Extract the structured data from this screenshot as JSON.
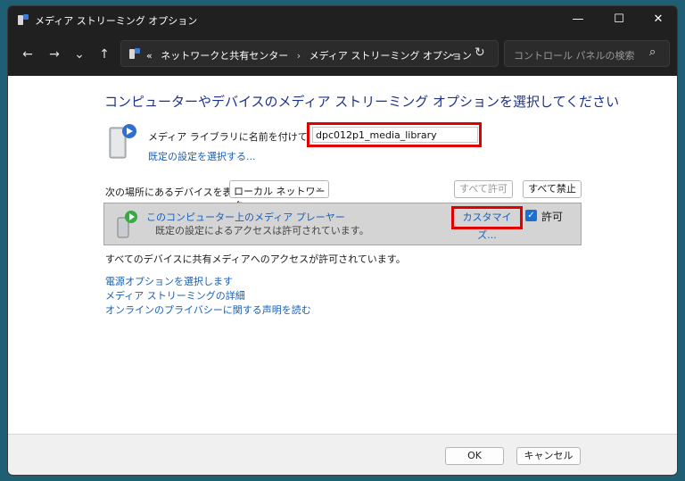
{
  "window": {
    "title": "メディア ストリーミング オプション",
    "minimize": "—",
    "maximize": "☐",
    "close": "✕"
  },
  "nav": {
    "back": "←",
    "forward": "→",
    "recent": "⌄",
    "up": "↑",
    "breadcrumb_prefix": "«",
    "crumbs": [
      "ネットワークと共有センター",
      "メディア ストリーミング オプション"
    ],
    "separator": "›",
    "dropdown": "⌄",
    "refresh": "↻",
    "search_placeholder": "コントロール パネルの検索",
    "search_icon": "⌕"
  },
  "main": {
    "heading": "コンピューターやデバイスのメディア ストリーミング オプションを選択してください",
    "library_label": "メディア ライブラリに名前を付けてください:",
    "library_name": "dpc012p1_media_library",
    "default_link": "既定の設定を選択する...",
    "show_devices_label": "次の場所にあるデバイスを表示:",
    "network_option": "ローカル ネットワーク",
    "allow_all": "すべて許可",
    "block_all": "すべて禁止",
    "device": {
      "name": "このコンピューター上のメディア プレーヤー",
      "description": "既定の設定によるアクセスは許可されています。",
      "customize": "カスタマイズ...",
      "allow_label": "許可",
      "allowed": true
    },
    "all_allowed_text": "すべてのデバイスに共有メディアへのアクセスが許可されています。",
    "links": [
      "電源オプションを選択します",
      "メディア ストリーミングの詳細",
      "オンラインのプライバシーに関する声明を読む"
    ]
  },
  "footer": {
    "ok": "OK",
    "cancel": "キャンセル"
  },
  "colors": {
    "highlight": "#e00000",
    "link": "#1a5fb4",
    "heading": "#1e3287"
  }
}
